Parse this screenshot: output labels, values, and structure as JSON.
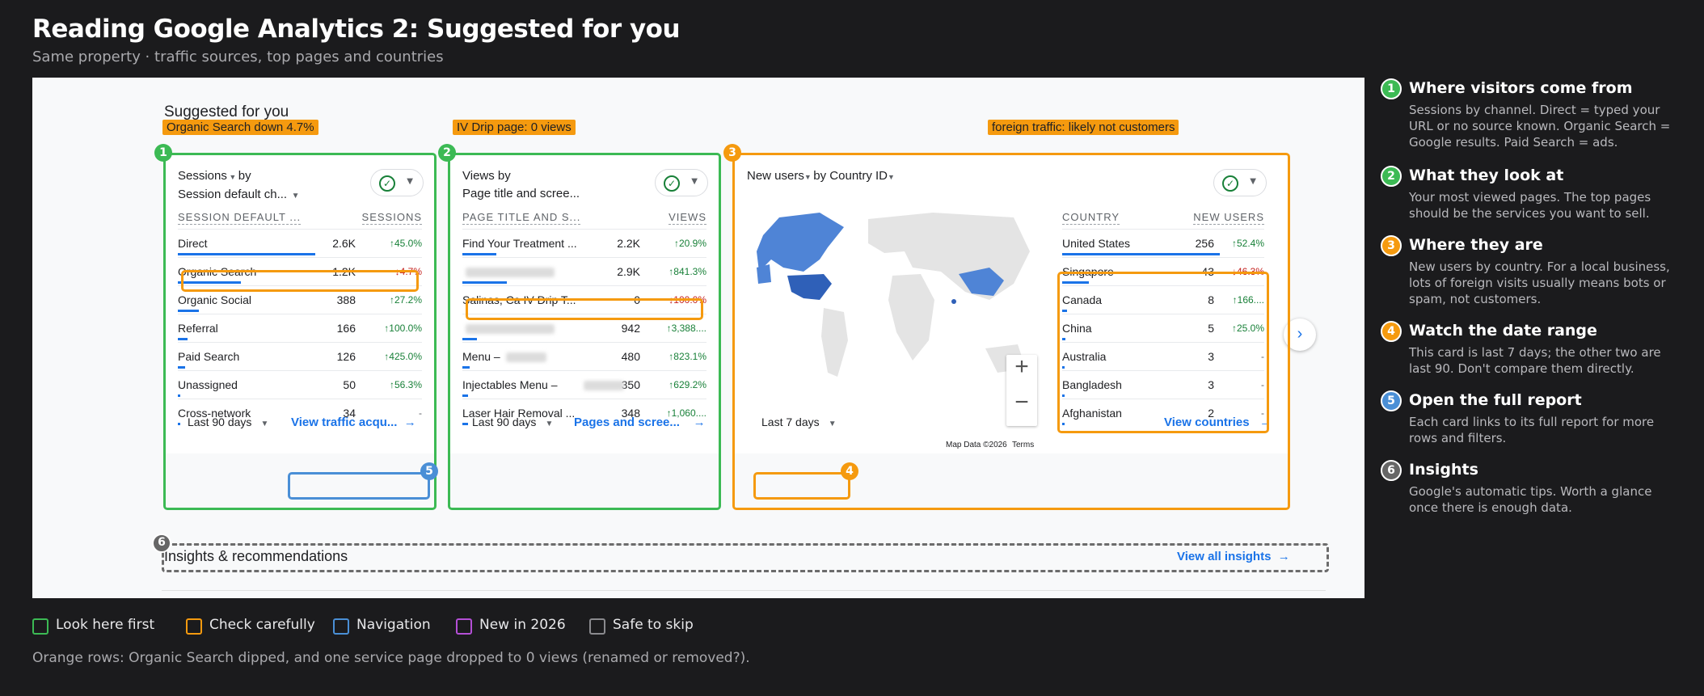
{
  "header": {
    "title": "Reading Google Analytics 2: Suggested for you",
    "subtitle": "Same property · traffic sources, top pages and countries"
  },
  "screenshot": {
    "section_title": "Suggested for you",
    "tags": {
      "organic": "Organic Search down 4.7%",
      "drip": "IV Drip page: 0 views",
      "foreign": "foreign traffic: likely not customers"
    },
    "card1": {
      "header_metric": "Sessions",
      "header_by": "by",
      "header_dim": "Session default ch...",
      "col_name": "SESSION DEFAULT ...",
      "col_value": "SESSIONS",
      "rows": [
        {
          "name": "Direct",
          "value": "2.6K",
          "change": "45.0%",
          "dir": "up",
          "bar": 1.0
        },
        {
          "name": "Organic Search",
          "value": "1.2K",
          "change": "4.7%",
          "dir": "down",
          "bar": 0.46
        },
        {
          "name": "Organic Social",
          "value": "388",
          "change": "27.2%",
          "dir": "up",
          "bar": 0.15
        },
        {
          "name": "Referral",
          "value": "166",
          "change": "100.0%",
          "dir": "up",
          "bar": 0.07
        },
        {
          "name": "Paid Search",
          "value": "126",
          "change": "425.0%",
          "dir": "up",
          "bar": 0.05
        },
        {
          "name": "Unassigned",
          "value": "50",
          "change": "56.3%",
          "dir": "up",
          "bar": 0.02
        },
        {
          "name": "Cross-network",
          "value": "34",
          "change": "-",
          "dir": "none",
          "bar": 0.01
        }
      ],
      "date_range": "Last 90 days",
      "link": "View traffic acqu..."
    },
    "card2": {
      "header_metric": "Views",
      "header_by": "by",
      "header_dim": "Page title and scree...",
      "col_name": "PAGE TITLE AND S...",
      "col_value": "VIEWS",
      "rows": [
        {
          "name": "Find Your Treatment ...",
          "value": "2.2K",
          "change": "20.9%",
          "dir": "up",
          "bar": 0.76
        },
        {
          "name": "",
          "value": "2.9K",
          "change": "841.3%",
          "dir": "up",
          "bar": 1.0
        },
        {
          "name": "Salinas, Ca IV Drip T...",
          "value": "0",
          "change": "100.0%",
          "dir": "down",
          "bar": 0.0
        },
        {
          "name": "",
          "value": "942",
          "change": "3,388....",
          "dir": "up",
          "bar": 0.32
        },
        {
          "name": "Menu –",
          "value": "480",
          "change": "823.1%",
          "dir": "up",
          "bar": 0.17
        },
        {
          "name": "Injectables Menu –",
          "value": "350",
          "change": "629.2%",
          "dir": "up",
          "bar": 0.12
        },
        {
          "name": "Laser Hair Removal ...",
          "value": "348",
          "change": "1,060....",
          "dir": "up",
          "bar": 0.12
        }
      ],
      "date_range": "Last 90 days",
      "link": "Pages and scree..."
    },
    "card3": {
      "header_metric": "New users",
      "header_by": "by",
      "header_dim": "Country ID",
      "col_name": "COUNTRY",
      "col_value": "NEW USERS",
      "rows": [
        {
          "name": "United States",
          "value": "256",
          "change": "52.4%",
          "dir": "up",
          "bar": 1.0
        },
        {
          "name": "Singapore",
          "value": "43",
          "change": "46.3%",
          "dir": "down",
          "bar": 0.17
        },
        {
          "name": "Canada",
          "value": "8",
          "change": "166....",
          "dir": "up",
          "bar": 0.03
        },
        {
          "name": "China",
          "value": "5",
          "change": "25.0%",
          "dir": "up",
          "bar": 0.02
        },
        {
          "name": "Australia",
          "value": "3",
          "change": "-",
          "dir": "none",
          "bar": 0.01
        },
        {
          "name": "Bangladesh",
          "value": "3",
          "change": "-",
          "dir": "none",
          "bar": 0.01
        },
        {
          "name": "Afghanistan",
          "value": "2",
          "change": "-",
          "dir": "none",
          "bar": 0.01
        }
      ],
      "map_credit": "Map Data ©2026",
      "map_terms": "Terms",
      "zoom_in": "+",
      "zoom_out": "−",
      "date_range": "Last 7 days",
      "link": "View countries"
    },
    "insights": {
      "title": "Insights & recommendations",
      "link": "View all insights"
    },
    "markers": [
      "1",
      "2",
      "3",
      "4",
      "5",
      "6"
    ]
  },
  "legend": [
    {
      "label": "Look here first",
      "color": "#3cba54"
    },
    {
      "label": "Check carefully",
      "color": "#f59a0f"
    },
    {
      "label": "Navigation",
      "color": "#4a8fd6"
    },
    {
      "label": "New in 2026",
      "color": "#b44fd6"
    },
    {
      "label": "Safe to skip",
      "color": "#8a8a8e"
    }
  ],
  "footnote": "Orange rows: Organic Search dipped, and one service page dropped to 0 views (renamed or removed?).",
  "sidebar": [
    {
      "num": "1",
      "color": "#3cba54",
      "heading": "Where visitors come from",
      "text": "Sessions by channel. Direct = typed your URL or no source known. Organic Search = Google results. Paid Search = ads."
    },
    {
      "num": "2",
      "color": "#3cba54",
      "heading": "What they look at",
      "text": "Your most viewed pages. The top pages should be the services you want to sell."
    },
    {
      "num": "3",
      "color": "#f59a0f",
      "heading": "Where they are",
      "text": "New users by country. For a local business, lots of foreign visits usually means bots or spam, not customers."
    },
    {
      "num": "4",
      "color": "#f59a0f",
      "heading": "Watch the date range",
      "text": "This card is last 7 days; the other two are last 90. Don't compare them directly."
    },
    {
      "num": "5",
      "color": "#4a8fd6",
      "heading": "Open the full report",
      "text": "Each card links to its full report for more rows and filters."
    },
    {
      "num": "6",
      "color": "#666666",
      "heading": "Insights",
      "text": "Google's automatic tips. Worth a glance once there is enough data."
    }
  ]
}
